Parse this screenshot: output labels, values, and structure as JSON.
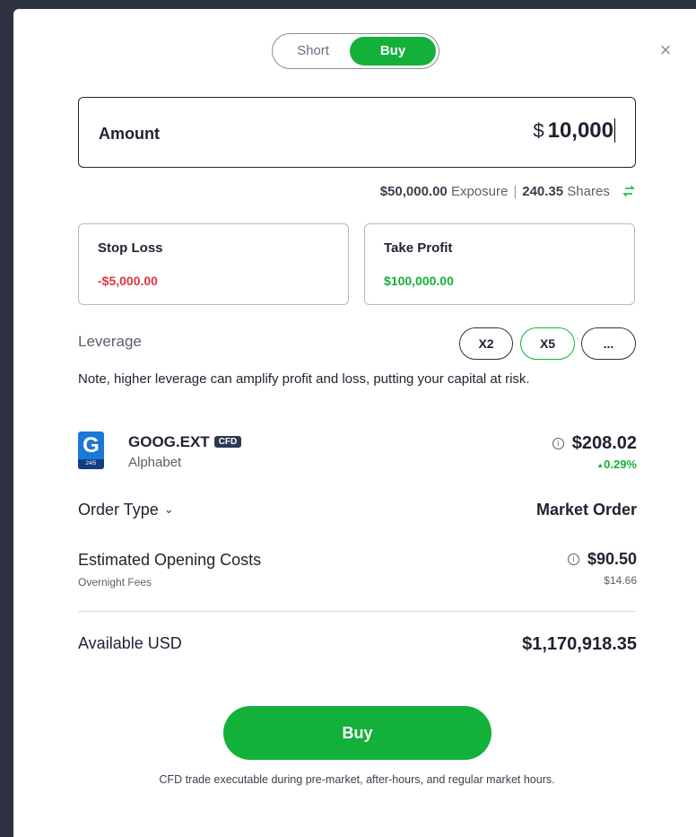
{
  "toggle": {
    "short_label": "Short",
    "buy_label": "Buy",
    "selected": "Buy"
  },
  "amount": {
    "label": "Amount",
    "currency": "$",
    "value": "10,000"
  },
  "exposure": {
    "exposure_value": "$50,000.00",
    "exposure_label": "Exposure",
    "shares_value": "240.35",
    "shares_label": "Shares"
  },
  "stop_loss": {
    "label": "Stop Loss",
    "value": "-$5,000.00"
  },
  "take_profit": {
    "label": "Take Profit",
    "value": "$100,000.00"
  },
  "leverage": {
    "label": "Leverage",
    "options": [
      "X2",
      "X5",
      "..."
    ],
    "selected": "X5",
    "note": "Note, higher leverage can amplify profit and loss, putting your capital at risk."
  },
  "instrument": {
    "logo_letter": "G",
    "logo_badge": "24/5",
    "ticker": "GOOG.EXT",
    "badge": "CFD",
    "name": "Alphabet",
    "price": "$208.02",
    "change": "0.29%"
  },
  "order_type": {
    "label": "Order Type",
    "value": "Market Order"
  },
  "costs": {
    "label": "Estimated Opening Costs",
    "value": "$90.50",
    "sub_label": "Overnight Fees",
    "sub_value": "$14.66"
  },
  "available": {
    "label": "Available USD",
    "value": "$1,170,918.35"
  },
  "buy_button": "Buy",
  "footnote": "CFD trade executable during pre-market, after-hours, and regular market hours.",
  "colors": {
    "accent": "#13b03a",
    "negative": "#e0343f",
    "logo_blue": "#1a78d6"
  }
}
